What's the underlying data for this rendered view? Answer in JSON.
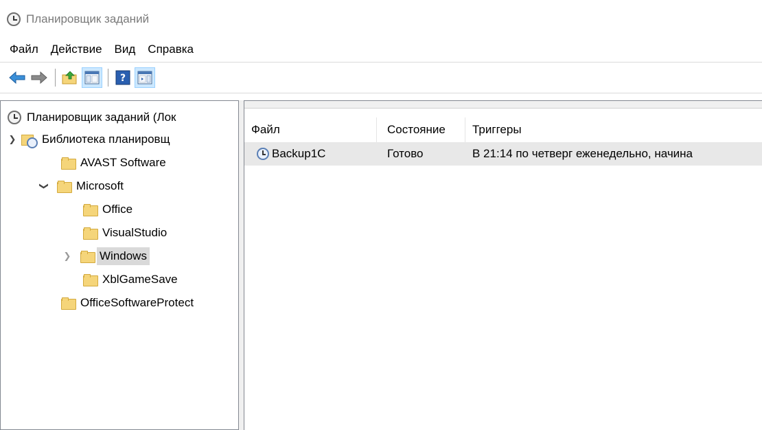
{
  "window": {
    "title": "Планировщик заданий"
  },
  "menu": [
    "Файл",
    "Действие",
    "Вид",
    "Справка"
  ],
  "toolbar": {
    "buttons": [
      "back-arrow-icon",
      "forward-arrow-icon",
      "folder-up-icon",
      "console-tree-icon",
      "help-icon",
      "action-pane-icon"
    ]
  },
  "tree": {
    "root": "Планировщик заданий (Лок",
    "library": "Библиотека планировщ",
    "avast": "AVAST Software",
    "microsoft": "Microsoft",
    "office": "Office",
    "visualstudio": "VisualStudio",
    "windows": "Windows",
    "xblgamesave": "XblGameSave",
    "officesoftwareprotect": "OfficeSoftwareProtect"
  },
  "table": {
    "columns": [
      "Файл",
      "Состояние",
      "Триггеры"
    ],
    "rows": [
      {
        "name": "Backup1C",
        "status": "Готово",
        "trigger": "В 21:14 по четверг еженедельно, начина"
      }
    ]
  }
}
